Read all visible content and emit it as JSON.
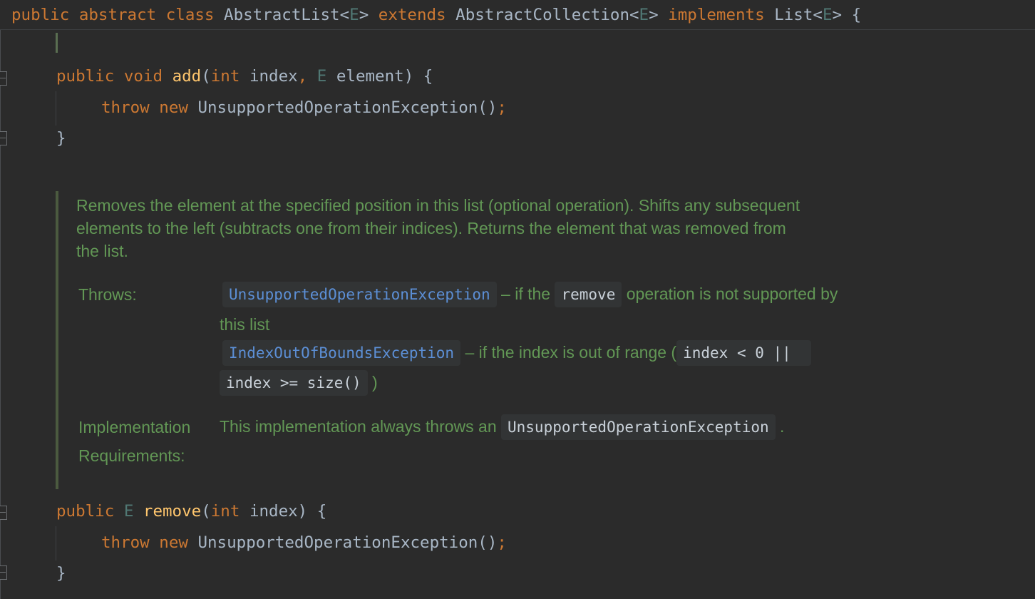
{
  "header": {
    "kw1": "public",
    "kw2": "abstract",
    "kw3": "class",
    "class_name": "AbstractList",
    "lt1": "<",
    "gen1": "E",
    "gt1": ">",
    "kw_extends": "extends",
    "parent": "AbstractCollection",
    "lt2": "<",
    "gen2": "E",
    "gt2": ">",
    "kw_implements": "implements",
    "iface": "List",
    "lt3": "<",
    "gen3": "E",
    "gt3": ">",
    "brace": "{"
  },
  "add_method": {
    "kw_public": "public",
    "kw_void": "void",
    "name": "add",
    "open": "(",
    "kw_int": "int",
    "p1": "index",
    "comma": ",",
    "gen": "E",
    "p2": "element",
    "close": ") {",
    "body_kw_throw": "throw",
    "body_kw_new": "new",
    "body_call": "UnsupportedOperationException()",
    "body_semi": ";",
    "end_brace": "}"
  },
  "doc": {
    "description_line1": "Removes the element at the specified position in this list (optional operation). Shifts any subsequent",
    "description_line2": "elements to the left (subtracts one from their indices). Returns the element that was removed from",
    "description_line3": "the list.",
    "throws_label": "Throws:",
    "throws1_exception": "UnsupportedOperationException",
    "throws1_text_a": "– if the",
    "throws1_code": "remove",
    "throws1_text_b": "operation is not supported by",
    "throws1_text_c": "this list",
    "throws2_exception": "IndexOutOfBoundsException",
    "throws2_text_a": "– if the index is out of range (",
    "throws2_code1": "index < 0 ||",
    "throws2_code2": "index >= size()",
    "throws2_text_b": ")",
    "impl_label_1": "Implementation",
    "impl_label_2": "Requirements:",
    "impl_text": "This implementation always throws an",
    "impl_code": "UnsupportedOperationException",
    "impl_period": "."
  },
  "remove_method": {
    "kw_public": "public",
    "gen": "E",
    "name": "remove",
    "open": "(",
    "kw_int": "int",
    "p1": "index",
    "close": ") {",
    "body_kw_throw": "throw",
    "body_kw_new": "new",
    "body_call": "UnsupportedOperationException()",
    "body_semi": ";",
    "end_brace": "}"
  },
  "colors": {
    "background": "#2b2b2b",
    "keyword": "#cc7832",
    "function": "#ffc66d",
    "doc_text": "#629755",
    "link": "#5c8fd6"
  }
}
